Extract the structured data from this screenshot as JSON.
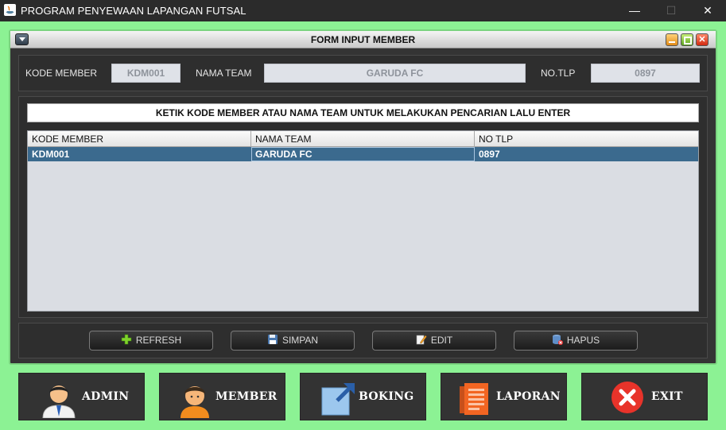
{
  "window": {
    "title": "PROGRAM PENYEWAAN LAPANGAN FUTSAL",
    "minimize_glyph": "—",
    "maximize_glyph": "☐",
    "close_glyph": "✕"
  },
  "internal_frame": {
    "title": "FORM INPUT MEMBER"
  },
  "form": {
    "kode_member_label": "KODE MEMBER",
    "kode_member_value": "KDM001",
    "nama_team_label": "NAMA TEAM",
    "nama_team_value": "GARUDA FC",
    "no_tlp_label": "NO.TLP",
    "no_tlp_value": "0897"
  },
  "search": {
    "text": "KETIK KODE MEMBER ATAU NAMA TEAM UNTUK MELAKUKAN PENCARIAN LALU ENTER"
  },
  "table": {
    "columns": [
      "KODE MEMBER",
      "NAMA TEAM",
      "NO TLP"
    ],
    "rows": [
      [
        "KDM001",
        "GARUDA FC",
        "0897"
      ]
    ]
  },
  "actions": {
    "refresh": "REFRESH",
    "simpan": "SIMPAN",
    "edit": "EDIT",
    "hapus": "HAPUS"
  },
  "nav": {
    "admin": "ADMIN",
    "member": "MEMBER",
    "boking": "BOKING",
    "laporan": "LAPORAN",
    "exit": "EXIT"
  },
  "icons": {
    "refresh": "plus-icon",
    "simpan": "floppy-disk-icon",
    "edit": "edit-pencil-icon",
    "hapus": "database-delete-icon",
    "admin": "admin-user-icon",
    "member": "member-person-icon",
    "boking": "external-link-icon",
    "laporan": "report-document-icon",
    "exit": "close-circle-icon"
  },
  "colors": {
    "frame_green": "#8cf294",
    "selected_row": "#3b6a8e",
    "exit_red": "#e8332a",
    "laporan_orange": "#f26522",
    "boking_blue": "#2a5fa8"
  }
}
